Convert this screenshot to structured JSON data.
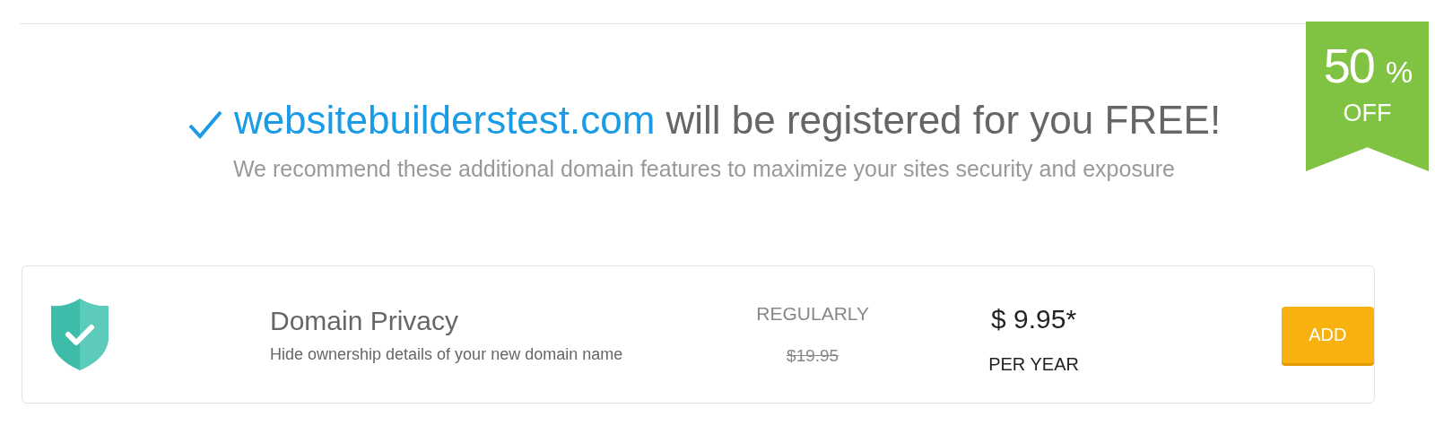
{
  "headline": {
    "domain": "websitebuilderstest.com",
    "rest": "will be registered for you FREE!"
  },
  "subtitle": "We recommend these additional domain features to maximize your sites security and exposure",
  "badge": {
    "amount": "50",
    "unit": "%",
    "label": "OFF"
  },
  "offer": {
    "title": "Domain Privacy",
    "description": "Hide ownership details of your new domain name",
    "regular_label": "REGULARLY",
    "regular_price": "$19.95",
    "price": "$ 9.95*",
    "period": "PER YEAR",
    "button": "ADD"
  }
}
